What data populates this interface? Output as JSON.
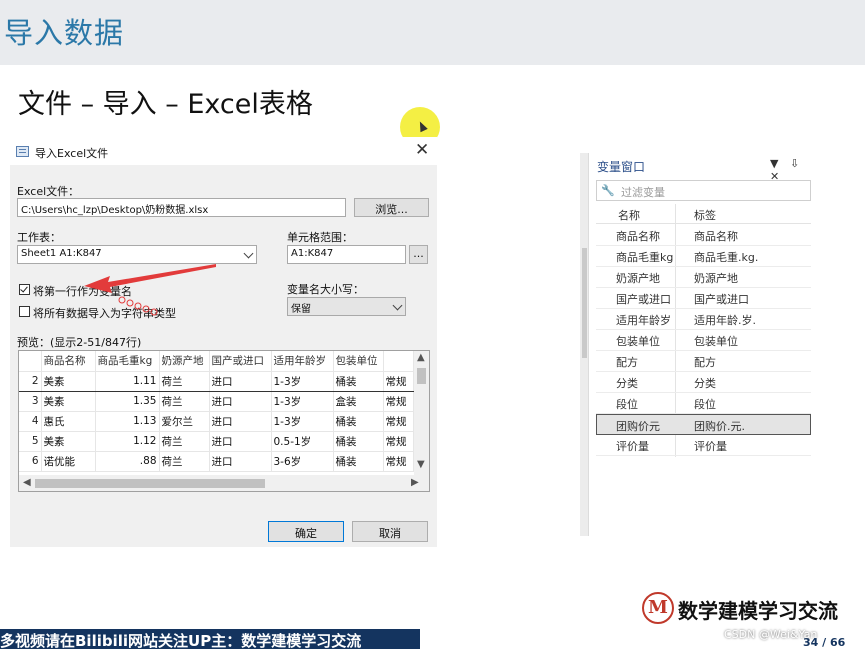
{
  "slide": {
    "title": "导入数据",
    "subtitle": "文件 – 导入 – Excel表格"
  },
  "dialog": {
    "title": "导入Excel文件",
    "close": "✕",
    "file_label": "Excel文件：",
    "file_path": "C:\\Users\\hc_lzp\\Desktop\\奶粉数据.xlsx",
    "browse_label": "浏览...",
    "sheet_label": "工作表：",
    "sheet_value": "Sheet1 A1:K847",
    "range_label": "单元格范围：",
    "range_value": "A1:K847",
    "range_button": "...",
    "first_row_names_label": "将第一行作为变量名",
    "first_row_names_checked": true,
    "all_as_string_label": "将所有数据导入为字符串类型",
    "all_as_string_checked": false,
    "case_label": "变量名大小写：",
    "case_value": "保留",
    "preview_label": "预览：(显示2-51/847行)",
    "columns": [
      "商品名称",
      "商品毛重kg",
      "奶源产地",
      "国产或进口",
      "适用年龄岁",
      "包装单位"
    ],
    "rows": [
      {
        "num": "2",
        "cells": [
          "美素",
          "1.11",
          "荷兰",
          "进口",
          "1-3岁",
          "桶装",
          "常规"
        ]
      },
      {
        "num": "3",
        "cells": [
          "美素",
          "1.35",
          "荷兰",
          "进口",
          "1-3岁",
          "盒装",
          "常规"
        ]
      },
      {
        "num": "4",
        "cells": [
          "惠氏",
          "1.13",
          "爱尔兰",
          "进口",
          "1-3岁",
          "桶装",
          "常规"
        ]
      },
      {
        "num": "5",
        "cells": [
          "美素",
          "1.12",
          "荷兰",
          "进口",
          "0.5-1岁",
          "桶装",
          "常规"
        ]
      },
      {
        "num": "6",
        "cells": [
          "诺优能",
          ".88",
          "荷兰",
          "进口",
          "3-6岁",
          "桶装",
          "常规"
        ]
      }
    ],
    "ok_label": "确定",
    "cancel_label": "取消"
  },
  "variable_window": {
    "title": "变量窗口",
    "tools": "▼ ⇩ ✕",
    "filter_placeholder": "过滤变量",
    "col_name": "名称",
    "col_label": "标签",
    "items": [
      {
        "name": "商品名称",
        "label": "商品名称"
      },
      {
        "name": "商品毛重kg",
        "label": "商品毛重.kg."
      },
      {
        "name": "奶源产地",
        "label": "奶源产地"
      },
      {
        "name": "国产或进口",
        "label": "国产或进口"
      },
      {
        "name": "适用年龄岁",
        "label": "适用年龄.岁."
      },
      {
        "name": "包装单位",
        "label": "包装单位"
      },
      {
        "name": "配方",
        "label": "配方"
      },
      {
        "name": "分类",
        "label": "分类"
      },
      {
        "name": "段位",
        "label": "段位"
      },
      {
        "name": "团购价元",
        "label": "团购价.元."
      },
      {
        "name": "评价量",
        "label": "评价量"
      }
    ],
    "selected_index": 9
  },
  "logo": {
    "mark": "M",
    "text": "数学建模学习交流"
  },
  "footer": {
    "banner": "多视频请在Bilibili网站关注UP主：数学建模学习交流",
    "watermark": "CSDN @Wei&Yan",
    "page": "34 / 66"
  },
  "colors": {
    "title": "#2b78a8",
    "banner": "#14345f",
    "annotation": "#e23b3b",
    "highlight": "#f3ee3a"
  }
}
